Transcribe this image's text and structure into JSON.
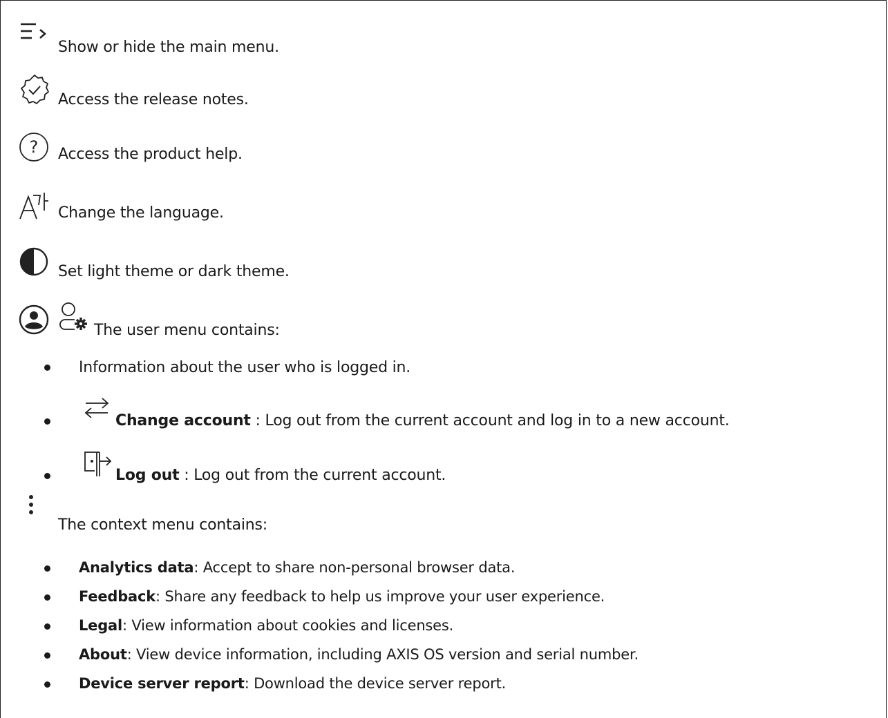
{
  "items": [
    {
      "icon": "menu-toggle-icon",
      "text": "Show or hide the main menu."
    },
    {
      "icon": "release-notes-icon",
      "text": "Access the release notes."
    },
    {
      "icon": "help-icon",
      "text": "Access the product help."
    },
    {
      "icon": "language-icon",
      "text": "Change the language."
    },
    {
      "icon": "theme-icon",
      "text": "Set light theme or dark theme."
    }
  ],
  "user_menu": {
    "icons": [
      "account-circle-icon",
      "user-settings-icon"
    ],
    "intro": "The user menu contains:",
    "entries": [
      {
        "icon": "",
        "bold": "",
        "text": "Information about the user who is logged in."
      },
      {
        "icon": "swap-arrows-icon",
        "bold": "Change account",
        "text": " : Log out from the current account and log in to a new account."
      },
      {
        "icon": "logout-icon",
        "bold": "Log out",
        "text": " : Log out from the current account."
      }
    ]
  },
  "context_menu": {
    "icon": "more-vertical-icon",
    "intro": "The context menu contains:",
    "entries": [
      {
        "bold": "Analytics data",
        "text": ": Accept to share non-personal browser data."
      },
      {
        "bold": "Feedback",
        "text": ": Share any feedback to help us improve your user experience."
      },
      {
        "bold": "Legal",
        "text": ": View information about cookies and licenses."
      },
      {
        "bold": "About",
        "text": ": View device information, including AXIS OS version and serial number."
      },
      {
        "bold": "Device server report",
        "text": ": Download the device server report."
      }
    ]
  }
}
